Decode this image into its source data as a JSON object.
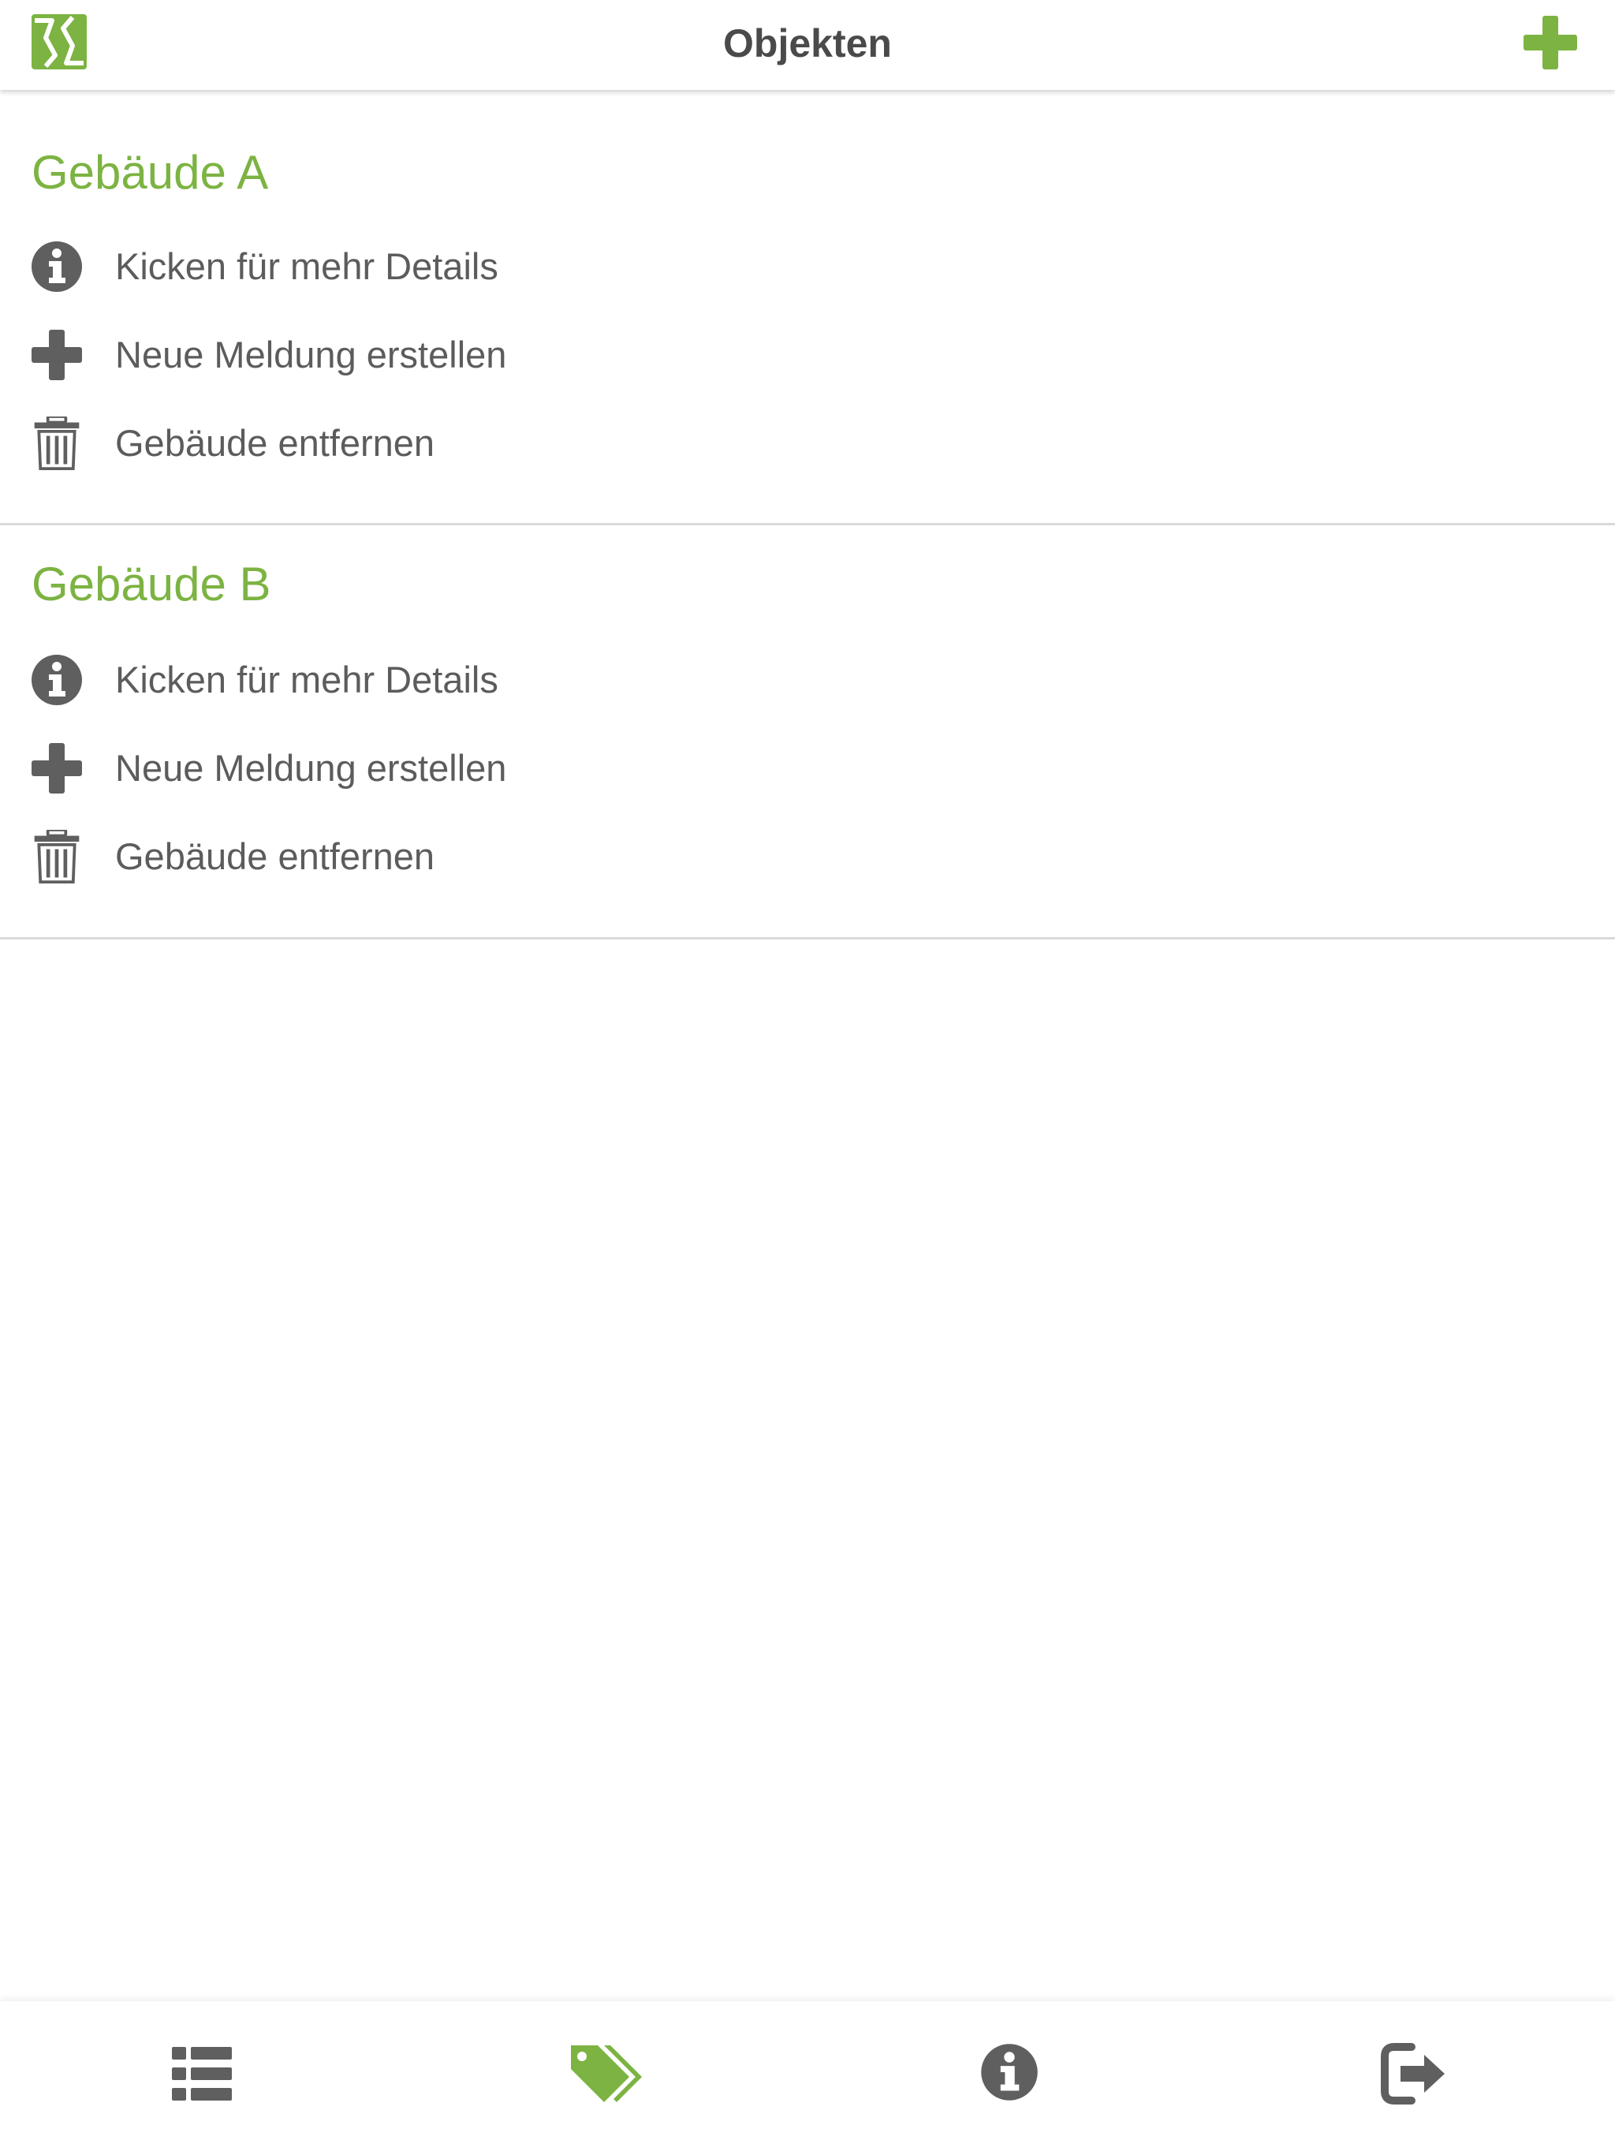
{
  "header": {
    "title": "Objekten",
    "logo_icon": "app-logo-icon",
    "add_icon": "plus-icon"
  },
  "colors": {
    "accent": "#7cb342",
    "text": "#5c5c5c",
    "title": "#4a4a4a",
    "icon": "#5f5f5f",
    "divider": "#d9d9d9"
  },
  "buildings": [
    {
      "name": "Gebäude A",
      "actions": [
        {
          "label": "Kicken für mehr Details",
          "icon": "info-icon"
        },
        {
          "label": "Neue Meldung erstellen",
          "icon": "plus-icon"
        },
        {
          "label": "Gebäude entfernen",
          "icon": "trash-icon"
        }
      ]
    },
    {
      "name": "Gebäude B",
      "actions": [
        {
          "label": "Kicken für mehr Details",
          "icon": "info-icon"
        },
        {
          "label": "Neue Meldung erstellen",
          "icon": "plus-icon"
        },
        {
          "label": "Gebäude entfernen",
          "icon": "trash-icon"
        }
      ]
    }
  ],
  "tabbar": {
    "tabs": [
      {
        "icon": "list-icon",
        "active": false
      },
      {
        "icon": "tags-icon",
        "active": true
      },
      {
        "icon": "info-icon",
        "active": false
      },
      {
        "icon": "logout-icon",
        "active": false
      }
    ]
  }
}
